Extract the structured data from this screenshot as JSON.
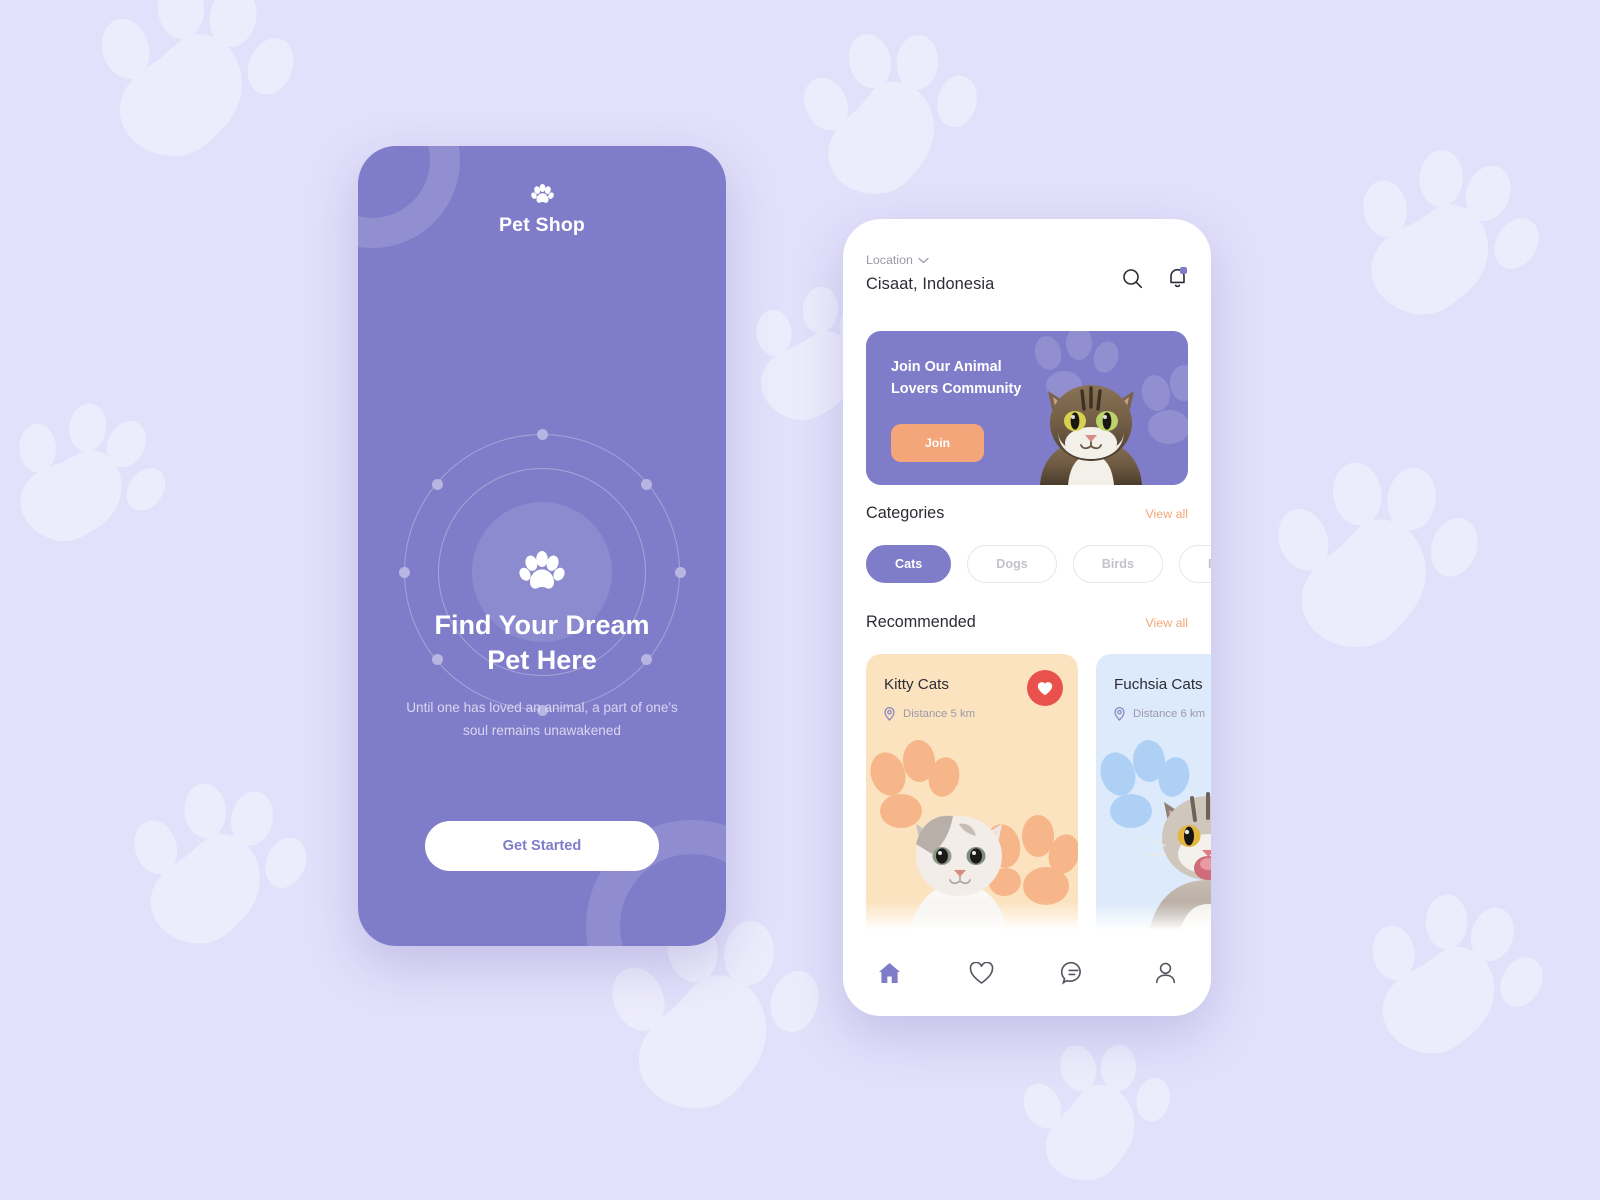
{
  "theme": {
    "background": "#E2E0FA",
    "brand_purple": "#7F7DC9",
    "accent_orange": "#F4A579",
    "favorite_red": "#E8514C",
    "card_peach": "#FBE3C0",
    "card_blue": "#DCEAFB",
    "text_dark": "#2C2C35",
    "text_muted": "#9C9AA8"
  },
  "onboarding": {
    "brand_icon": "paw-icon",
    "brand_name": "Pet Shop",
    "hero_icon": "paw-icon",
    "headline_line1": "Find Your Dream",
    "headline_line2": "Pet Here",
    "subtext": "Until one has loved an animal, a part of one's soul remains unawakened",
    "cta_label": "Get Started"
  },
  "home": {
    "location_label": "Location",
    "location_chevron_icon": "chevron-down-icon",
    "location_value": "Cisaat, Indonesia",
    "search_icon": "search-icon",
    "notification_icon": "bell-icon",
    "notification_has_badge": true,
    "banner": {
      "title_line1": "Join Our Animal",
      "title_line2": "Lovers Community",
      "button_label": "Join",
      "image_alt": "tabby-cat-photo"
    },
    "categories": {
      "title": "Categories",
      "view_all": "View all",
      "chips": [
        {
          "label": "Cats",
          "active": true
        },
        {
          "label": "Dogs",
          "active": false
        },
        {
          "label": "Birds",
          "active": false
        },
        {
          "label": "Fishes",
          "active": false
        }
      ]
    },
    "recommended": {
      "title": "Recommended",
      "view_all": "View all",
      "cards": [
        {
          "name": "Kitty Cats",
          "pin_icon": "location-pin-icon",
          "distance": "Distance 5 km",
          "favorite": true,
          "favorite_icon": "heart-filled-icon",
          "bg": "#FBE3C0",
          "paw_color": "#F6B68A",
          "image_alt": "grey-white-kitten-photo"
        },
        {
          "name": "Fuchsia Cats",
          "pin_icon": "location-pin-icon",
          "distance": "Distance 6 km",
          "favorite": false,
          "favorite_icon": "heart-filled-icon",
          "bg": "#DCEAFB",
          "paw_color": "#AED0F5",
          "image_alt": "tabby-cat-meowing-photo"
        }
      ]
    },
    "navbar": [
      {
        "icon": "home-icon",
        "active": true
      },
      {
        "icon": "heart-icon",
        "active": false
      },
      {
        "icon": "chat-icon",
        "active": false
      },
      {
        "icon": "profile-icon",
        "active": false
      }
    ]
  }
}
